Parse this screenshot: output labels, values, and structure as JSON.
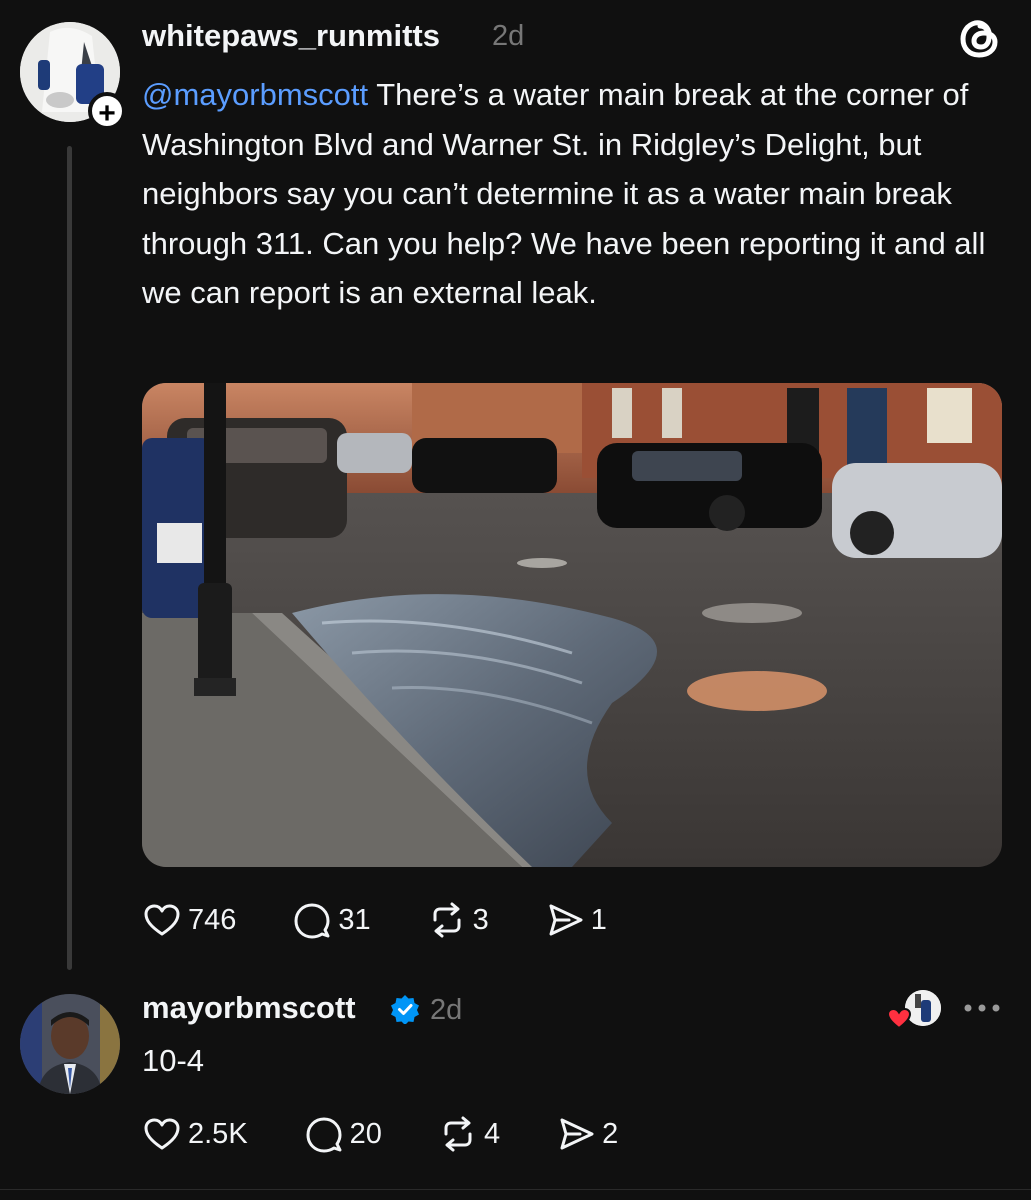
{
  "post1": {
    "username": "whitepaws_runmitts",
    "time": "2d",
    "mention": "@mayorbmscott",
    "text": " There’s a water main break at the corner of Washington Blvd and Warner St. in Ridgley’s Delight, but neighbors say you can’t determine it as a water main break through 311. Can you help? We have been reporting it and all we can report is an external leak.",
    "follow_badge": "+",
    "actions": {
      "likes": "746",
      "replies": "31",
      "reposts": "3",
      "shares": "1"
    }
  },
  "post2": {
    "username": "mayorbmscott",
    "time": "2d",
    "text": "10-4",
    "actions": {
      "likes": "2.5K",
      "replies": "20",
      "reposts": "4",
      "shares": "2"
    }
  },
  "icons": {
    "app_logo": "threads-logo-icon",
    "like": "heart-icon",
    "reply": "speech-bubble-icon",
    "repost": "repost-icon",
    "share": "paper-plane-icon",
    "verified": "verified-badge-icon",
    "more": "ellipsis-icon"
  },
  "colors": {
    "background": "#101010",
    "text": "#f3f5f7",
    "muted": "#777777",
    "mention": "#5b9dff",
    "verified": "#0095f6",
    "heart": "#ff3040"
  }
}
